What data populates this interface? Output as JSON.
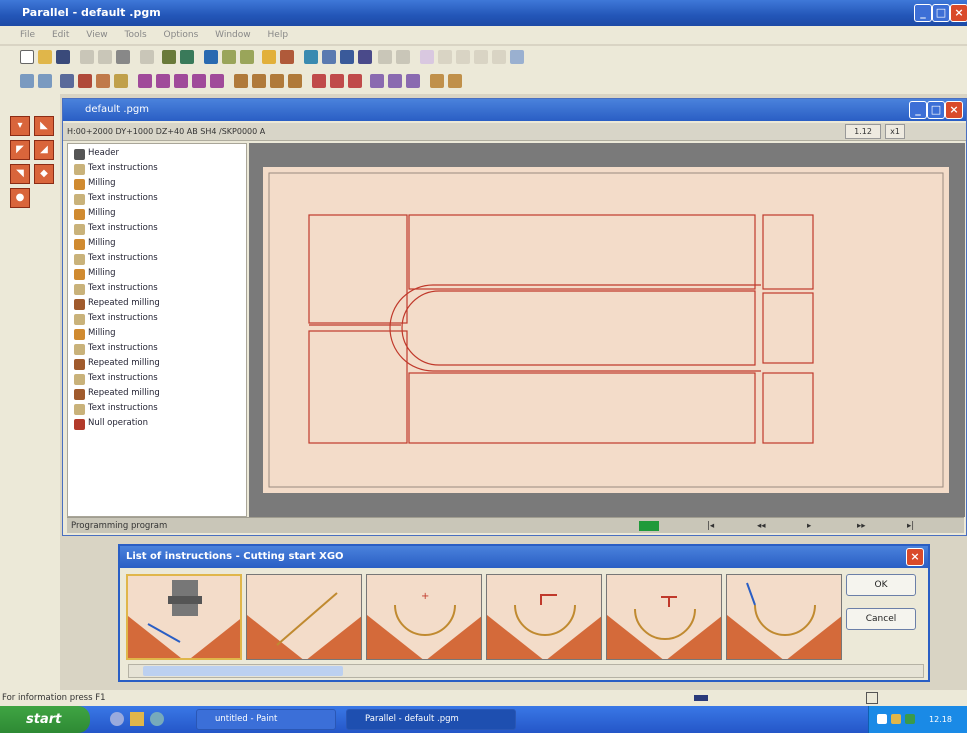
{
  "window": {
    "title": "Parallel - default .pgm"
  },
  "menu": [
    "File",
    "Edit",
    "View",
    "Tools",
    "Options",
    "Window",
    "Help"
  ],
  "inner_window": {
    "title": "default .pgm",
    "path_text": "H:00+2000 DY+1000 DZ+40 AB SH4 /SKP0000 A",
    "zoom": "1.12",
    "zoom2": "x1",
    "status_text": "Programming program"
  },
  "tree": [
    {
      "label": "Header",
      "icon": "header-icon",
      "color": "#555555"
    },
    {
      "label": "Text instructions",
      "icon": "text-icon",
      "color": "#c9b27a"
    },
    {
      "label": "Milling",
      "icon": "milling-icon",
      "color": "#d08a30"
    },
    {
      "label": "Text instructions",
      "icon": "text-icon",
      "color": "#c9b27a"
    },
    {
      "label": "Milling",
      "icon": "milling-icon",
      "color": "#d08a30"
    },
    {
      "label": "Text instructions",
      "icon": "text-icon",
      "color": "#c9b27a"
    },
    {
      "label": "Milling",
      "icon": "milling-icon",
      "color": "#d08a30"
    },
    {
      "label": "Text instructions",
      "icon": "text-icon",
      "color": "#c9b27a"
    },
    {
      "label": "Milling",
      "icon": "milling-icon",
      "color": "#d08a30"
    },
    {
      "label": "Text instructions",
      "icon": "text-icon",
      "color": "#c9b27a"
    },
    {
      "label": "Repeated milling",
      "icon": "repeat-icon",
      "color": "#a05a2c"
    },
    {
      "label": "Text instructions",
      "icon": "text-icon",
      "color": "#c9b27a"
    },
    {
      "label": "Milling",
      "icon": "milling-icon",
      "color": "#d08a30"
    },
    {
      "label": "Text instructions",
      "icon": "text-icon",
      "color": "#c9b27a"
    },
    {
      "label": "Repeated milling",
      "icon": "repeat-icon",
      "color": "#a05a2c"
    },
    {
      "label": "Text instructions",
      "icon": "text-icon",
      "color": "#c9b27a"
    },
    {
      "label": "Repeated milling",
      "icon": "repeat-icon",
      "color": "#a05a2c"
    },
    {
      "label": "Text instructions",
      "icon": "text-icon",
      "color": "#c9b27a"
    },
    {
      "label": "Null operation",
      "icon": "null-icon",
      "color": "#b23a2a"
    }
  ],
  "dialog": {
    "title": "List of instructions - Cutting start XGO",
    "ok_label": "OK",
    "cancel_label": "Cancel"
  },
  "status_bar": {
    "text": "For information press  F1"
  },
  "taskbar": {
    "start_label": "start",
    "task1": "untitled - Paint",
    "task2": "Parallel - default .pgm",
    "clock": "12.18"
  },
  "colors": {
    "accent": "#2a5ec4",
    "drawing_bg": "#f3dcc9",
    "drawing_line": "#c0392b"
  }
}
